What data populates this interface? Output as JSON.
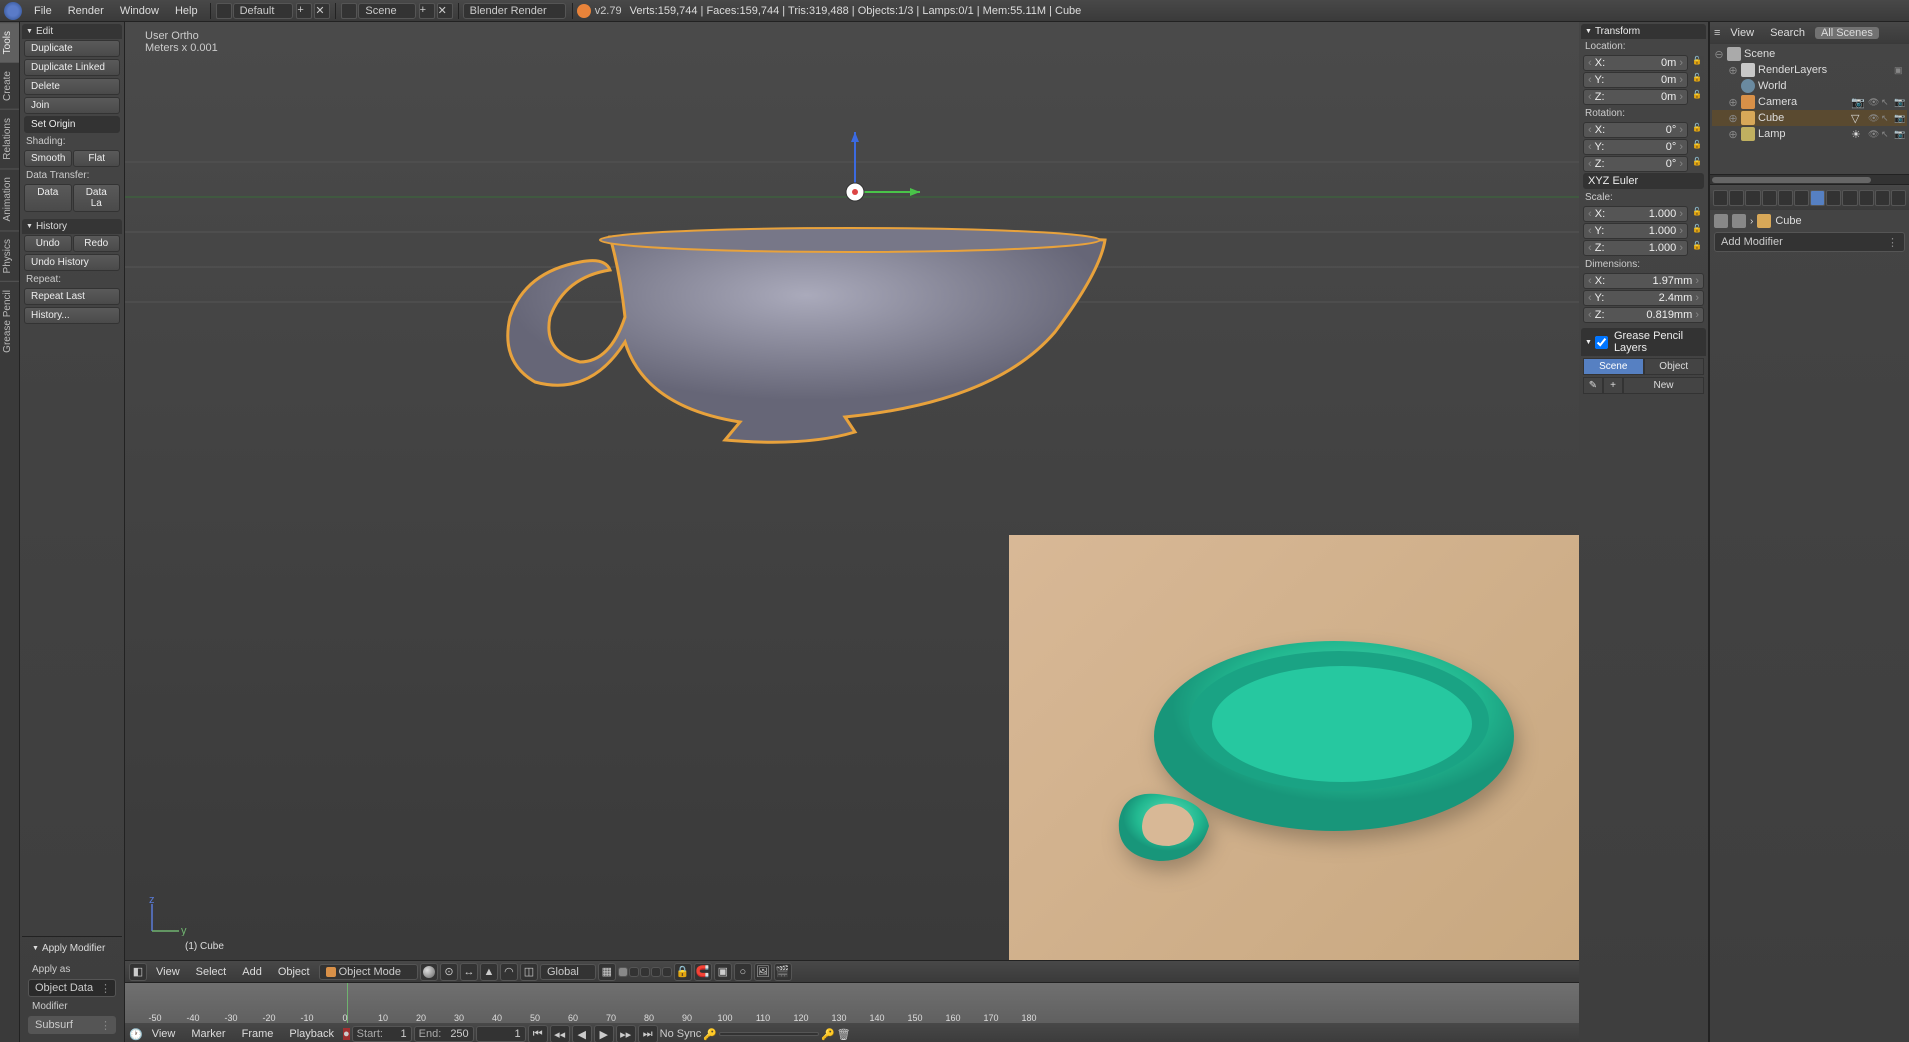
{
  "top_menu": {
    "items": [
      "File",
      "Render",
      "Window",
      "Help"
    ],
    "layout_dropdown": "Default",
    "scene_dropdown": "Scene",
    "engine_dropdown": "Blender Render",
    "version": "v2.79",
    "stats": "Verts:159,744 | Faces:159,744 | Tris:319,488 | Objects:1/3 | Lamps:0/1 | Mem:55.11M | Cube"
  },
  "vert_tabs": [
    "Tools",
    "Create",
    "Relations",
    "Animation",
    "Physics",
    "Grease Pencil"
  ],
  "toolshelf": {
    "edit_header": "Edit",
    "duplicate": "Duplicate",
    "duplicate_linked": "Duplicate Linked",
    "delete": "Delete",
    "join": "Join",
    "set_origin": "Set Origin",
    "shading_label": "Shading:",
    "smooth": "Smooth",
    "flat": "Flat",
    "data_transfer_label": "Data Transfer:",
    "data": "Data",
    "data_la": "Data La",
    "history_header": "History",
    "undo": "Undo",
    "redo": "Redo",
    "undo_history": "Undo History",
    "repeat_label": "Repeat:",
    "repeat_last": "Repeat Last",
    "history_more": "History..."
  },
  "op_panel": {
    "header": "Apply Modifier",
    "apply_as_label": "Apply as",
    "apply_as_value": "Object Data",
    "modifier_label": "Modifier",
    "modifier_value": "Subsurf"
  },
  "viewport": {
    "info_line1": "User Ortho",
    "info_line2": "Meters x 0.001",
    "object_name": "(1) Cube",
    "header_menus": [
      "View",
      "Select",
      "Add",
      "Object"
    ],
    "mode": "Object Mode",
    "orientation": "Global"
  },
  "n_panel": {
    "transform_header": "Transform",
    "location_label": "Location:",
    "loc": [
      {
        "a": "X:",
        "v": "0m"
      },
      {
        "a": "Y:",
        "v": "0m"
      },
      {
        "a": "Z:",
        "v": "0m"
      }
    ],
    "rotation_label": "Rotation:",
    "rot": [
      {
        "a": "X:",
        "v": "0°"
      },
      {
        "a": "Y:",
        "v": "0°"
      },
      {
        "a": "Z:",
        "v": "0°"
      }
    ],
    "rot_mode": "XYZ Euler",
    "scale_label": "Scale:",
    "scale": [
      {
        "a": "X:",
        "v": "1.000"
      },
      {
        "a": "Y:",
        "v": "1.000"
      },
      {
        "a": "Z:",
        "v": "1.000"
      }
    ],
    "dim_label": "Dimensions:",
    "dim": [
      {
        "a": "X:",
        "v": "1.97mm"
      },
      {
        "a": "Y:",
        "v": "2.4mm"
      },
      {
        "a": "Z:",
        "v": "0.819mm"
      }
    ],
    "gp_header": "Grease Pencil Layers",
    "gp_scene": "Scene",
    "gp_object": "Object",
    "gp_new": "New"
  },
  "outliner": {
    "header_menus": [
      "View",
      "Search"
    ],
    "filter": "All Scenes",
    "tree": {
      "scene": "Scene",
      "render": "RenderLayers",
      "world": "World",
      "camera": "Camera",
      "cube": "Cube",
      "lamp": "Lamp"
    }
  },
  "props": {
    "crumb": "Cube",
    "add_modifier": "Add Modifier"
  },
  "timeline": {
    "ticks": [
      "-50",
      "-40",
      "-30",
      "-20",
      "-10",
      "0",
      "10",
      "20",
      "30",
      "40",
      "50",
      "60",
      "70",
      "80",
      "90",
      "100",
      "110",
      "120",
      "130",
      "140",
      "150",
      "160",
      "170",
      "180"
    ],
    "header_menus": [
      "View",
      "Marker",
      "Frame",
      "Playback"
    ],
    "start_label": "Start:",
    "start_val": "1",
    "end_label": "End:",
    "end_val": "250",
    "cur_val": "1",
    "sync": "No Sync"
  }
}
